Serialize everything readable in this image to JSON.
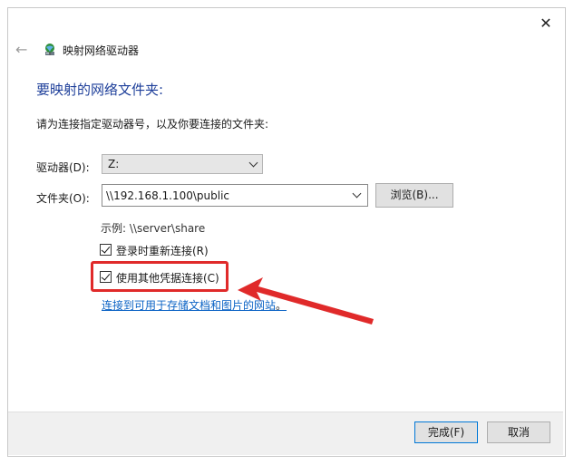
{
  "window": {
    "title": "映射网络驱动器",
    "close_glyph": "✕",
    "back_glyph": "←"
  },
  "main": {
    "heading": "要映射的网络文件夹:",
    "instruction": "请为连接指定驱动器号，以及你要连接的文件夹:",
    "drive_label": "驱动器(D):",
    "drive_value": "Z:",
    "folder_label": "文件夹(O):",
    "folder_value": "\\\\192.168.1.100\\public",
    "browse_label": "浏览(B)...",
    "example": "示例: \\\\server\\share",
    "reconnect_label": "登录时重新连接(R)",
    "reconnect_checked": true,
    "credentials_label": "使用其他凭据连接(C)",
    "credentials_checked": true,
    "link_text": "连接到可用于存储文档和图片的网站",
    "link_suffix": "。"
  },
  "footer": {
    "finish_label": "完成(F)",
    "cancel_label": "取消"
  },
  "colors": {
    "heading": "#1e3f9a",
    "link": "#0b63c5",
    "annotation": "#e02a2a",
    "default_button_border": "#0078d7"
  },
  "icons": {
    "network_drive": "network-drive-icon",
    "back": "back-arrow-icon",
    "close": "close-icon",
    "dropdown": "chevron-down-icon",
    "checkbox": "checkmark-icon"
  }
}
